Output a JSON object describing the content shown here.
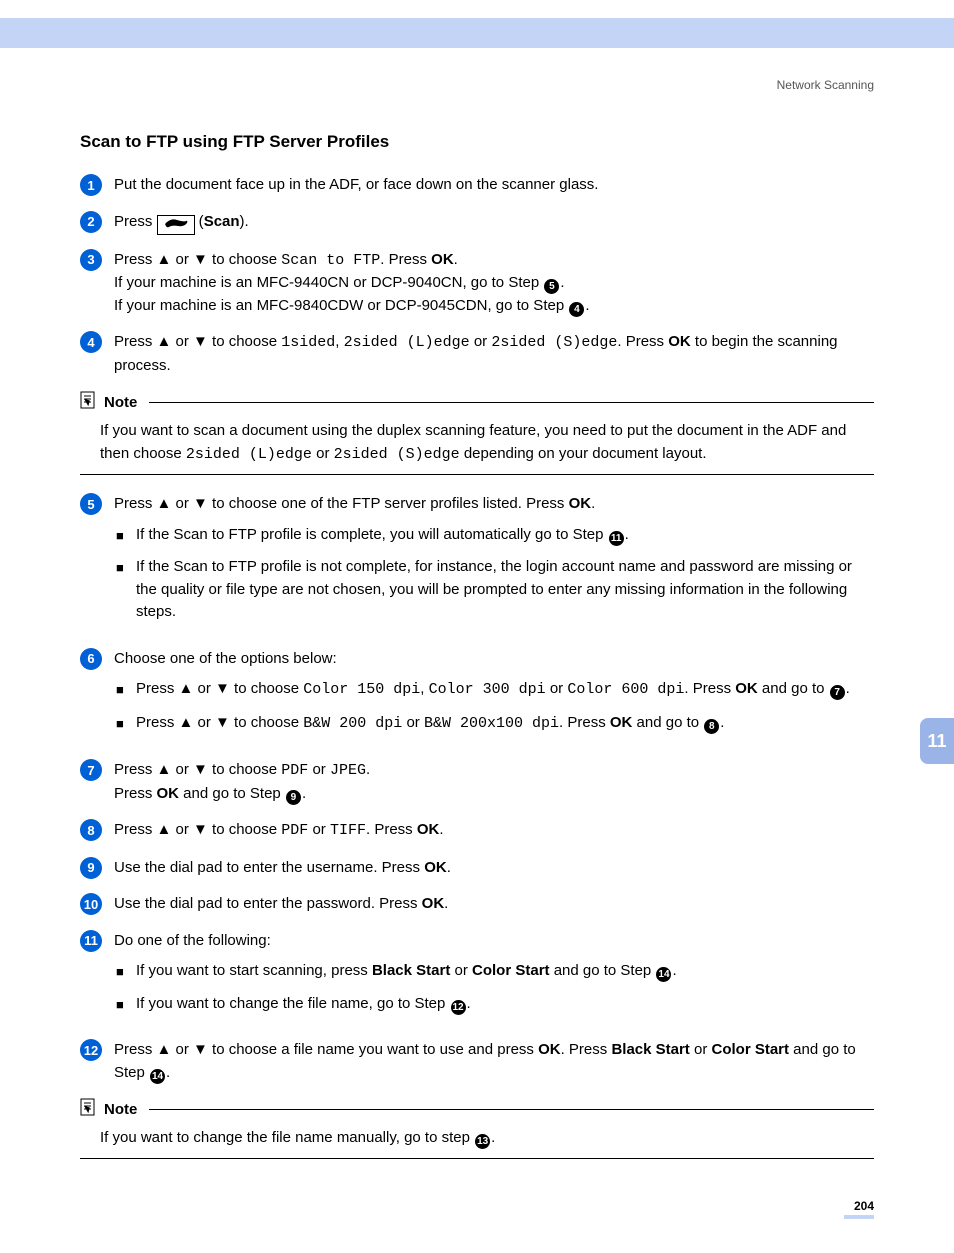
{
  "breadcrumb": "Network Scanning",
  "heading": "Scan to FTP using FTP Server Profiles",
  "steps": {
    "s1": "Put the document face up in the ADF, or face down on the scanner glass.",
    "s2_a": "Press ",
    "s2_scan_icon": "⎙",
    "s2_b": " (",
    "s2_scan": "Scan",
    "s2_c": ").",
    "s3_a": "Press ▲ or ▼ to choose ",
    "s3_m": "Scan to FTP",
    "s3_b": ". Press ",
    "s3_ok": "OK",
    "s3_c": ".",
    "s3_d": "If your machine is an MFC-9440CN or DCP-9040CN, go to Step ",
    "s3_e": ".",
    "s3_f": "If your machine is an MFC-9840CDW or DCP-9045CDN, go to Step ",
    "s3_g": ".",
    "s4_a": "Press ▲ or ▼ to choose ",
    "s4_m1": "1sided",
    "s4_b": ", ",
    "s4_m2": "2sided (L)edge",
    "s4_c": " or ",
    "s4_m3": "2sided (S)edge",
    "s4_d": ".  Press ",
    "s4_ok": "OK",
    "s4_e": " to begin the scanning process.",
    "s5_a": "Press ▲ or ▼ to choose one of the FTP server profiles listed.  Press ",
    "s5_ok": "OK",
    "s5_b": ".",
    "s5_sub1_a": "If the Scan to FTP profile is complete, you will automatically go to Step ",
    "s5_sub1_b": ".",
    "s5_sub2": "If the Scan to FTP profile is not complete, for instance, the login account name and password are missing or the quality or file type are not chosen, you will be prompted to enter any missing information in the following steps.",
    "s6_a": "Choose one of the options below:",
    "s6_sub1_a": "Press ▲ or ▼ to choose ",
    "s6_sub1_m1": "Color 150 dpi",
    "s6_sub1_b": ", ",
    "s6_sub1_m2": "Color 300 dpi",
    "s6_sub1_c": " or ",
    "s6_sub1_m3": "Color 600 dpi",
    "s6_sub1_d": ". Press ",
    "s6_sub1_ok": "OK",
    "s6_sub1_e": " and go to ",
    "s6_sub1_f": ".",
    "s6_sub2_a": "Press ▲ or ▼ to choose ",
    "s6_sub2_m1": "B&W 200 dpi",
    "s6_sub2_b": " or ",
    "s6_sub2_m2": "B&W 200x100 dpi",
    "s6_sub2_c": ". Press ",
    "s6_sub2_ok": "OK",
    "s6_sub2_d": " and go to ",
    "s6_sub2_e": ".",
    "s7_a": "Press ▲ or ▼ to choose ",
    "s7_m1": "PDF",
    "s7_b": " or ",
    "s7_m2": "JPEG",
    "s7_c": ".",
    "s7_d": "Press ",
    "s7_ok": "OK",
    "s7_e": " and go to Step ",
    "s7_f": ".",
    "s8_a": "Press ▲ or ▼ to choose ",
    "s8_m1": "PDF",
    "s8_b": " or ",
    "s8_m2": "TIFF",
    "s8_c": ".  Press ",
    "s8_ok": "OK",
    "s8_d": ".",
    "s9_a": "Use the dial pad to enter the username. Press ",
    "s9_ok": "OK",
    "s9_b": ".",
    "s10_a": "Use the dial pad to enter the password. Press ",
    "s10_ok": "OK",
    "s10_b": ".",
    "s11_a": "Do one of the following:",
    "s11_sub1_a": "If you want to start scanning, press ",
    "s11_sub1_bs": "Black Start",
    "s11_sub1_b": " or ",
    "s11_sub1_cs": "Color Start",
    "s11_sub1_c": " and go to Step ",
    "s11_sub1_d": ".",
    "s11_sub2_a": "If you want to change the file name, go to Step ",
    "s11_sub2_b": ".",
    "s12_a": "Press ▲ or ▼ to choose a file name you want to use and press ",
    "s12_ok": "OK",
    "s12_b": ". Press ",
    "s12_bs": "Black Start",
    "s12_c": " or ",
    "s12_cs": "Color Start",
    "s12_d": " and go to Step ",
    "s12_e": "."
  },
  "refs": {
    "r5": "5",
    "r4": "4",
    "r7": "7",
    "r8": "8",
    "r9": "9",
    "r11": "11",
    "r12": "12",
    "r13": "13",
    "r14": "14"
  },
  "notes": {
    "label": "Note",
    "n1_a": "If you want to scan a document using the duplex scanning feature, you need to put the document in the ADF and then choose ",
    "n1_m1": "2sided (L)edge",
    "n1_b": " or ",
    "n1_m2": "2sided (S)edge",
    "n1_c": " depending on your document layout.",
    "n2_a": "If you want to change the file name manually, go to step ",
    "n2_b": "."
  },
  "side_tab": "11",
  "page_num": "204"
}
